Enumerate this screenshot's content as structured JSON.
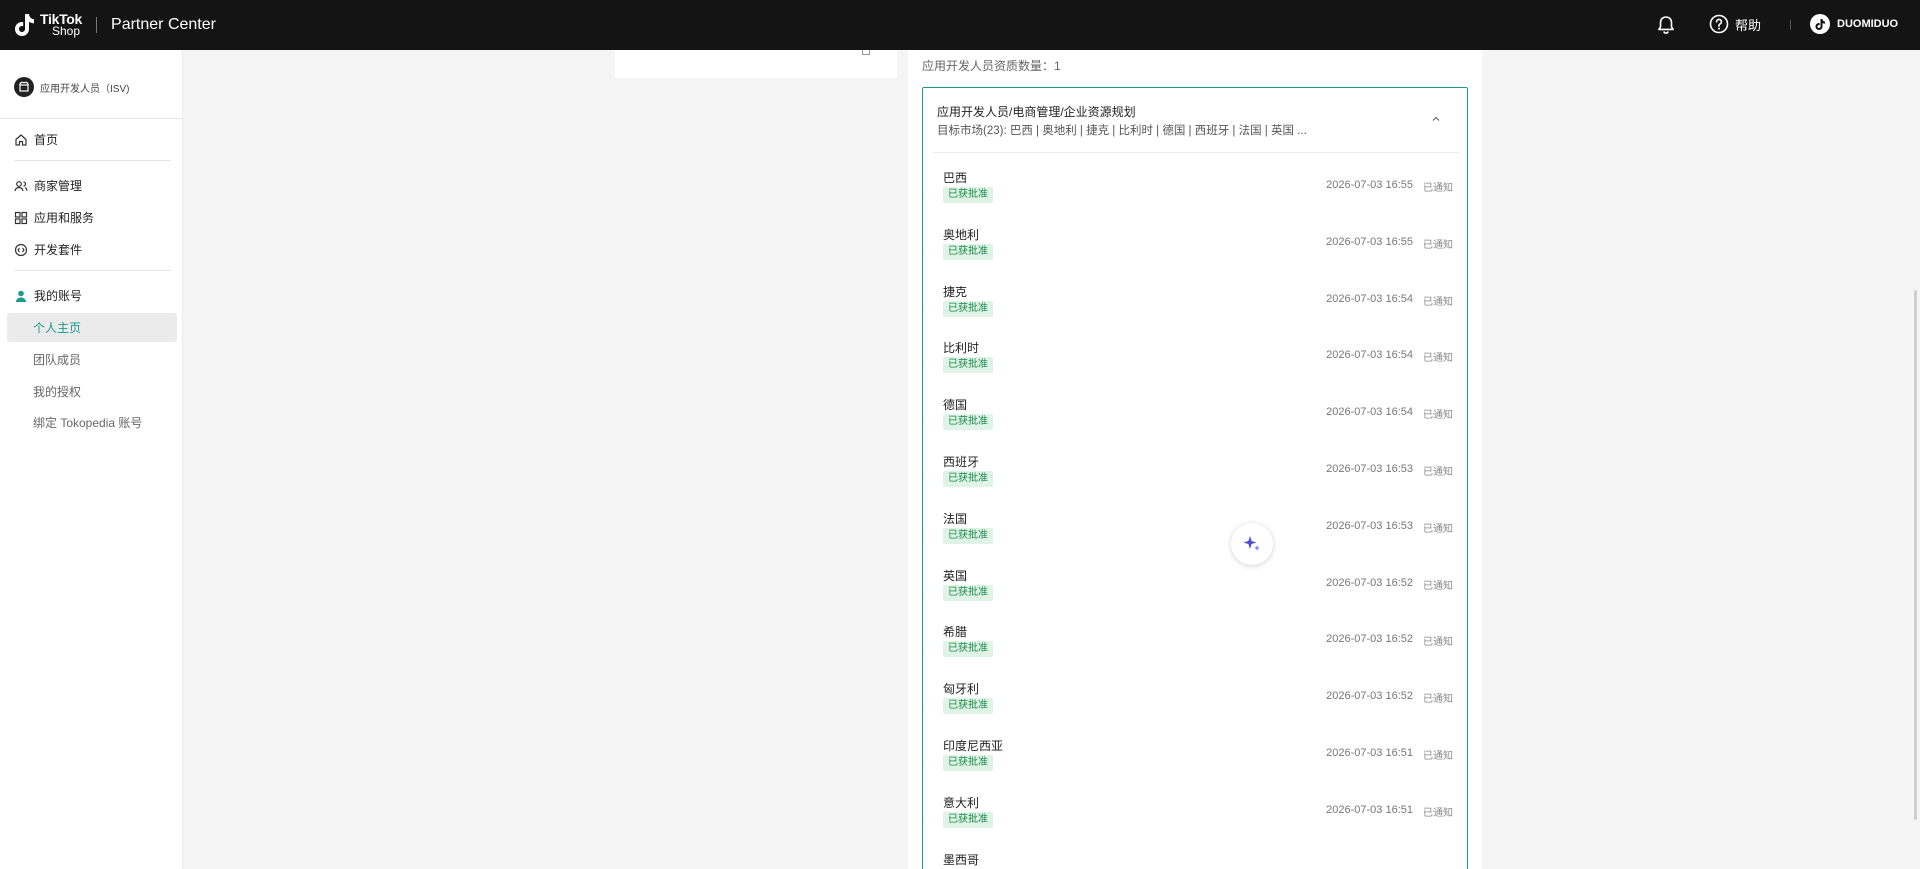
{
  "topbar": {
    "brand_line1": "TikTok",
    "brand_line2": "Shop",
    "title": "Partner Center",
    "help_label": "帮助",
    "username": "DUOMIDUO"
  },
  "sidebar": {
    "role_label": "应用开发人员（ISV)",
    "home": "首页",
    "merchant": "商家管理",
    "apps": "应用和服务",
    "devkit": "开发套件",
    "account": "我的账号",
    "sub_items": [
      "个人主页",
      "团队成员",
      "我的授权",
      "绑定 Tokopedia 账号"
    ]
  },
  "main": {
    "count_text": "应用开发人员资质数量：1",
    "card_title": "应用开发人员/电商管理/企业资源规划",
    "card_subtitle": "目标市场(23): 巴西 | 奥地利 | 捷克 | 比利时 | 德国 | 西班牙 | 法国 | 英国 ...",
    "markets": [
      {
        "name": "巴西",
        "status": "已获批准",
        "time": "2026-07-03 16:55",
        "note": "已通知"
      },
      {
        "name": "奥地利",
        "status": "已获批准",
        "time": "2026-07-03 16:55",
        "note": "已通知"
      },
      {
        "name": "捷克",
        "status": "已获批准",
        "time": "2026-07-03 16:54",
        "note": "已通知"
      },
      {
        "name": "比利时",
        "status": "已获批准",
        "time": "2026-07-03 16:54",
        "note": "已通知"
      },
      {
        "name": "德国",
        "status": "已获批准",
        "time": "2026-07-03 16:54",
        "note": "已通知"
      },
      {
        "name": "西班牙",
        "status": "已获批准",
        "time": "2026-07-03 16:53",
        "note": "已通知"
      },
      {
        "name": "法国",
        "status": "已获批准",
        "time": "2026-07-03 16:53",
        "note": "已通知"
      },
      {
        "name": "英国",
        "status": "已获批准",
        "time": "2026-07-03 16:52",
        "note": "已通知"
      },
      {
        "name": "希腊",
        "status": "已获批准",
        "time": "2026-07-03 16:52",
        "note": "已通知"
      },
      {
        "name": "匈牙利",
        "status": "已获批准",
        "time": "2026-07-03 16:52",
        "note": "已通知"
      },
      {
        "name": "印度尼西亚",
        "status": "已获批准",
        "time": "2026-07-03 16:51",
        "note": "已通知"
      },
      {
        "name": "意大利",
        "status": "已获批准",
        "time": "2026-07-03 16:51",
        "note": "已通知"
      },
      {
        "name": "墨西哥",
        "status": "",
        "time": "",
        "note": ""
      }
    ]
  },
  "colors": {
    "accent": "#1b9a8e",
    "badge_bg": "#dff3e6",
    "badge_text": "#1a8a4a",
    "topbar_bg": "#141414"
  }
}
